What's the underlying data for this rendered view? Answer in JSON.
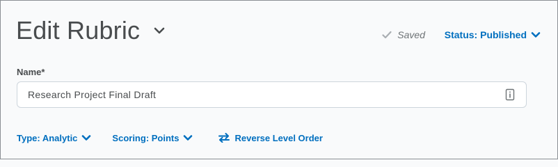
{
  "header": {
    "title": "Edit Rubric",
    "saved_label": "Saved",
    "status_label": "Status: Published"
  },
  "form": {
    "name_label": "Name*",
    "name_value": "Research Project Final Draft"
  },
  "options": {
    "type_label": "Type: Analytic",
    "scoring_label": "Scoring: Points",
    "reverse_label": "Reverse Level Order"
  },
  "icons": {
    "title_menu": "chevron-down-icon",
    "saved": "checkmark-icon",
    "status": "chevron-down-icon",
    "input": "field-info-icon",
    "type": "chevron-down-icon",
    "scoring": "chevron-down-icon",
    "reverse": "swap-arrows-icon"
  },
  "colors": {
    "link": "#006fbf",
    "text": "#494c4e",
    "muted": "#6e7376",
    "background": "#f9fafb"
  }
}
